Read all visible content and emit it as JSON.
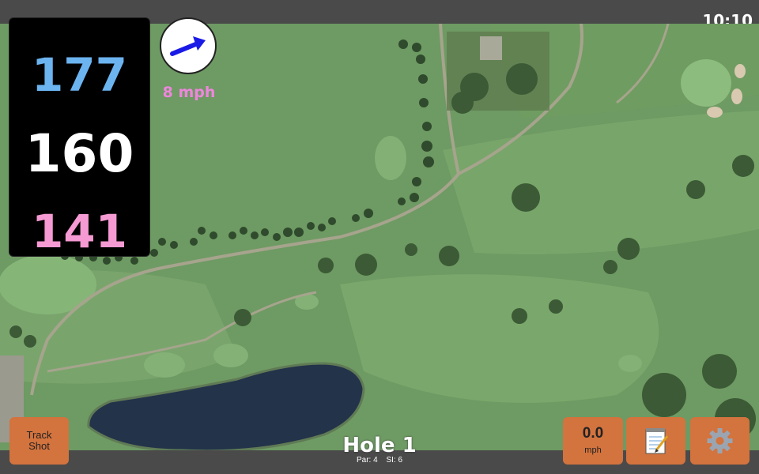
{
  "status_bar": {
    "time": "10:10"
  },
  "yardage": {
    "back": "177",
    "middle": "160",
    "front": "141"
  },
  "wind": {
    "speed": "8 mph",
    "direction_icon": "arrow-right-icon",
    "arrow_color": "#1a1ae6"
  },
  "hole": {
    "title": "Hole 1",
    "par": "Par: 4",
    "si": "SI: 6"
  },
  "buttons": {
    "track_shot": {
      "line1": "Track",
      "line2": "Shot"
    },
    "speed": {
      "value": "0.0",
      "unit": "mph"
    },
    "notes": {
      "icon": "notepad-icon"
    },
    "settings": {
      "icon": "gear-icon"
    }
  },
  "colors": {
    "back": "#6cb4f0",
    "middle": "#ffffff",
    "front": "#f59ad2",
    "wind_text": "#ee86dd",
    "button": "#d3733e",
    "bar": "#4a4a4a"
  }
}
